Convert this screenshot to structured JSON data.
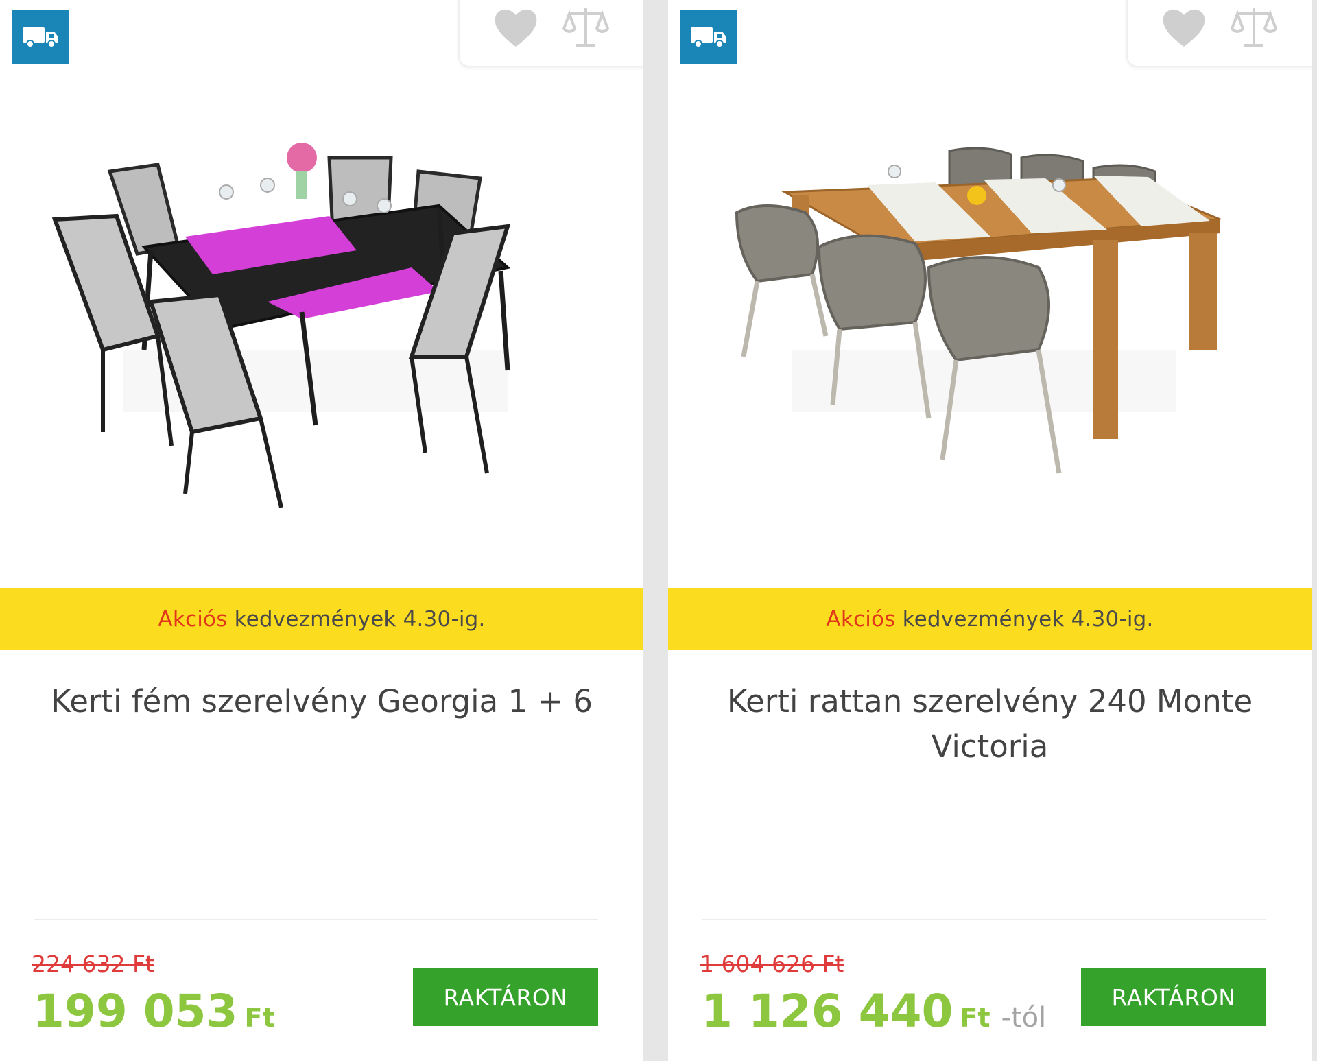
{
  "products": [
    {
      "image": "garden metal dining set with table and six grey chairs",
      "promo": {
        "accent": "Akciós",
        "rest": " kedvezmények 4.30-ig."
      },
      "title": "Kerti fém szerelvény Georgia 1 + 6",
      "old_price": "224 632 Ft",
      "price": "199 053",
      "currency": "Ft",
      "price_suffix": "",
      "stock_label": "RAKTÁRON"
    },
    {
      "image": "garden rattan dining set with wooden table and six wicker chairs",
      "promo": {
        "accent": "Akciós",
        "rest": " kedvezmények 4.30-ig."
      },
      "title": "Kerti rattan szerelvény 240 Monte Victoria",
      "old_price": "1 604 626 Ft",
      "price": "1 126 440",
      "currency": "Ft",
      "price_suffix": "-tól",
      "stock_label": "RAKTÁRON"
    }
  ],
  "colors": {
    "badge": "#1a86b8",
    "promo_bg": "#fbdc1f",
    "promo_accent": "#e0361a",
    "old_price": "#df3b3b",
    "price": "#8dc63f",
    "stock_button": "#35a22c"
  },
  "icons": [
    "delivery-truck-icon",
    "heart-icon",
    "compare-scale-icon"
  ]
}
